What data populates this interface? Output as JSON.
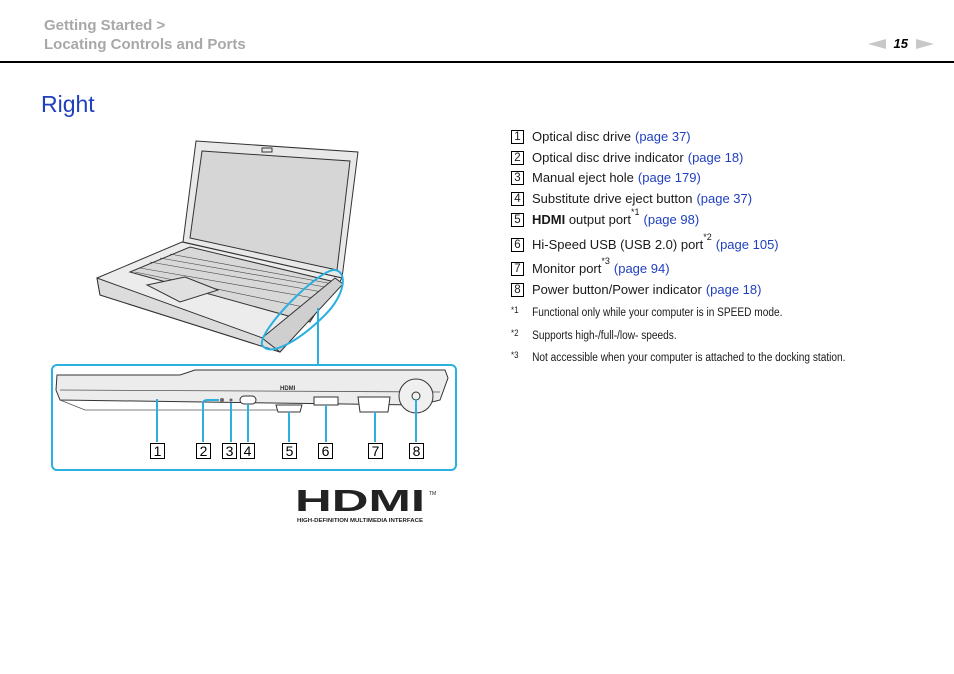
{
  "header": {
    "breadcrumb_parent": "Getting Started >",
    "breadcrumb_current": "Locating Controls and Ports",
    "page_number": "15",
    "prev_icon": "arrow-left-icon",
    "next_icon": "arrow-right-icon"
  },
  "section_title": "Right",
  "items": [
    {
      "num": "1",
      "label_bold": "",
      "label": "Optical disc drive",
      "sup": "",
      "link": "(page 37)"
    },
    {
      "num": "2",
      "label_bold": "",
      "label": "Optical disc drive indicator",
      "sup": "",
      "link": "(page 18)"
    },
    {
      "num": "3",
      "label_bold": "",
      "label": "Manual eject hole",
      "sup": "",
      "link": "(page 179)"
    },
    {
      "num": "4",
      "label_bold": "",
      "label": "Substitute drive eject button",
      "sup": "",
      "link": "(page 37)"
    },
    {
      "num": "5",
      "label_bold": "HDMI",
      "label": " output port",
      "sup": "*1",
      "link": "(page 98)"
    },
    {
      "num": "6",
      "label_bold": "",
      "label": "Hi-Speed USB (USB 2.0) port",
      "sup": "*2",
      "link": "(page 105)"
    },
    {
      "num": "7",
      "label_bold": "",
      "label": "Monitor port",
      "sup": "*3",
      "link": "(page 94)"
    },
    {
      "num": "8",
      "label_bold": "",
      "label": "Power button/Power indicator",
      "sup": "",
      "link": "(page 18)"
    }
  ],
  "footnotes": [
    {
      "mark": "*1",
      "text": "Functional only while your computer is in SPEED mode."
    },
    {
      "mark": "*2",
      "text": "Supports high-/full-/low- speeds."
    },
    {
      "mark": "*3",
      "text": "Not accessible when your computer is attached to the docking station."
    }
  ],
  "figure": {
    "callout_numbers": [
      "1",
      "2",
      "3",
      "4",
      "5",
      "6",
      "7",
      "8"
    ],
    "port_label_hdmi": "HDMI",
    "accent_color": "#2bb0e0"
  },
  "hdmi_logo": {
    "wordmark": "HDMI",
    "trademark": "TM",
    "tagline": "HIGH-DEFINITION MULTIMEDIA INTERFACE"
  }
}
